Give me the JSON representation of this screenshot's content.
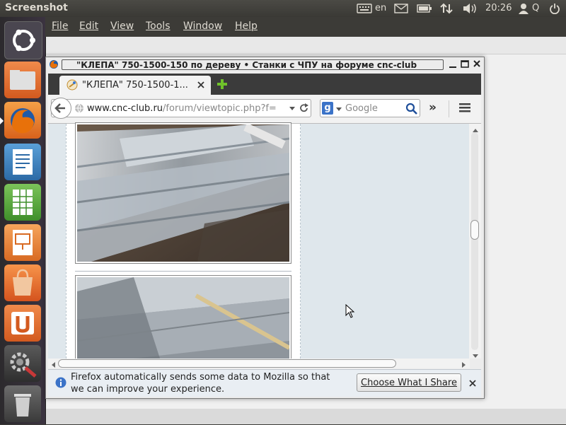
{
  "top_panel": {
    "title": "Screenshot",
    "keyboard_layout": "en",
    "clock": "20:26",
    "user": "Q"
  },
  "menubar": {
    "items": [
      "File",
      "Edit",
      "View",
      "Tools",
      "Window",
      "Help"
    ]
  },
  "launcher": {
    "items": [
      "dash-home",
      "files",
      "firefox",
      "libreoffice-writer",
      "libreoffice-calc",
      "libreoffice-impress",
      "ubuntu-software-center",
      "ubuntu-one",
      "system-settings",
      "trash"
    ]
  },
  "browser": {
    "window_title": "\"КЛЕПА\" 750-1500-150 по дереву • Станки с ЧПУ на форуме cnc-club",
    "tab_title": "\"КЛЕПА\" 750-1500-1...",
    "url_domain": "www.cnc-club.ru",
    "url_path": "/forum/viewtopic.php?f=",
    "search_placeholder": "Google",
    "overflow_label": "»"
  },
  "notification": {
    "text": "Firefox automatically sends some data to Mozilla so that we can improve your experience.",
    "button_label": "Choose What I Share"
  },
  "colors": {
    "panel": "#3c3b37",
    "firefox_orange": "#e66000",
    "ubuntu_launcher": "#2c2a2d"
  }
}
